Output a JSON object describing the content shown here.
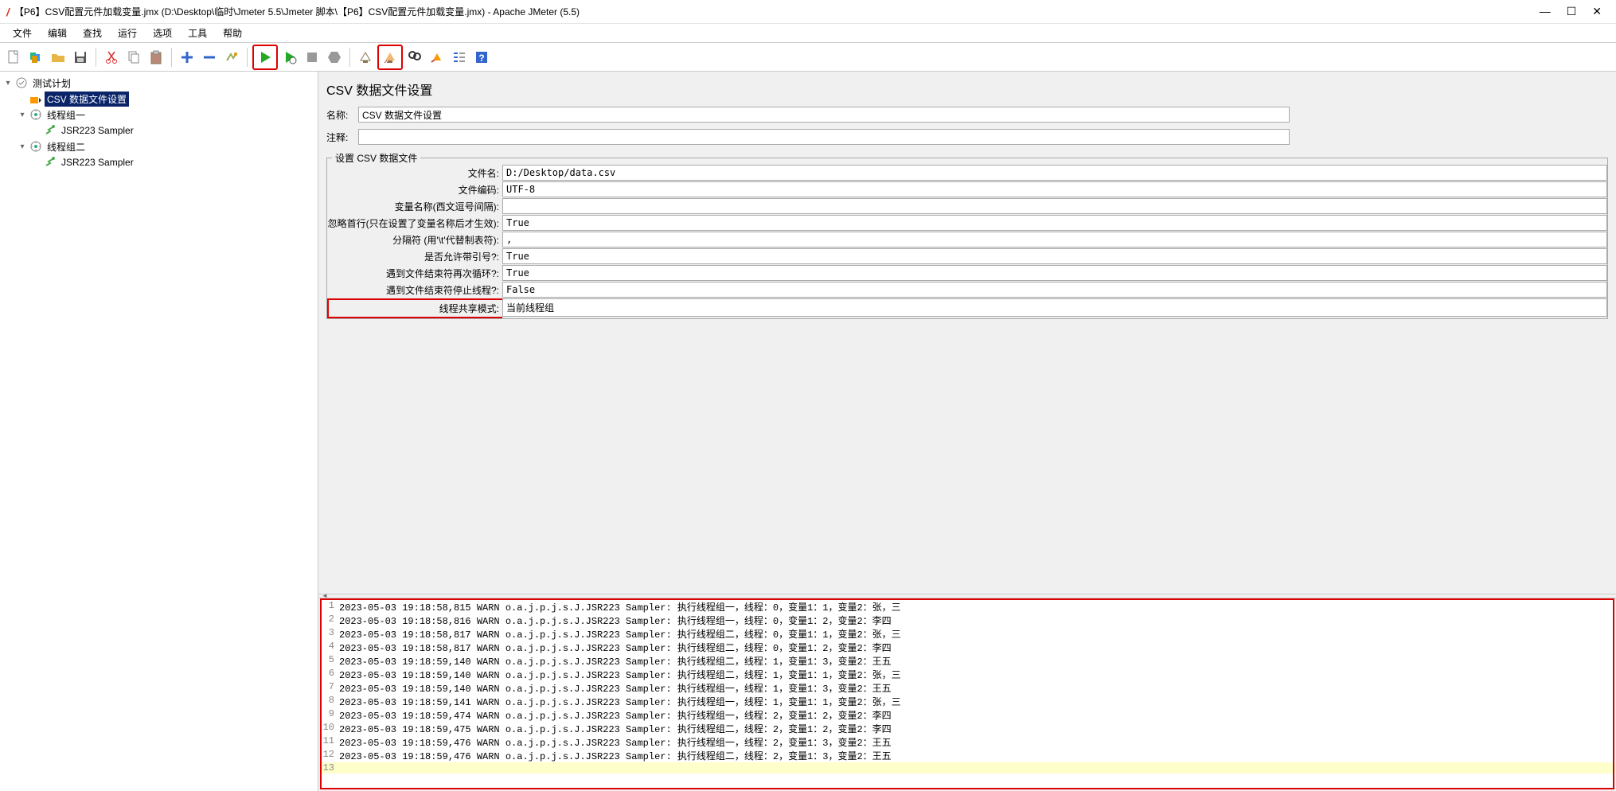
{
  "titlebar": {
    "title": "【P6】CSV配置元件加载变量.jmx (D:\\Desktop\\临时\\Jmeter 5.5\\Jmeter 脚本\\【P6】CSV配置元件加载变量.jmx) - Apache JMeter (5.5)"
  },
  "menu": {
    "file": "文件",
    "edit": "编辑",
    "search": "查找",
    "run": "运行",
    "options": "选项",
    "tools": "工具",
    "help": "帮助"
  },
  "tree": {
    "root": "测试计划",
    "csv": "CSV 数据文件设置",
    "group1": "线程组一",
    "sampler1": "JSR223 Sampler",
    "group2": "线程组二",
    "sampler2": "JSR223 Sampler"
  },
  "panel": {
    "title": "CSV 数据文件设置",
    "name_label": "名称:",
    "name_value": "CSV 数据文件设置",
    "comment_label": "注释:",
    "comment_value": "",
    "fieldset_title": "设置 CSV 数据文件",
    "fields": {
      "filename_label": "文件名:",
      "filename_value": "D:/Desktop/data.csv",
      "encoding_label": "文件编码:",
      "encoding_value": "UTF-8",
      "varnames_label": "变量名称(西文逗号间隔):",
      "varnames_value": "",
      "ignore_first_label": "忽略首行(只在设置了变量名称后才生效):",
      "ignore_first_value": "True",
      "delimiter_label": "分隔符 (用'\\t'代替制表符):",
      "delimiter_value": ",",
      "quoted_label": "是否允许带引号?:",
      "quoted_value": "True",
      "recycle_label": "遇到文件结束符再次循环?:",
      "recycle_value": "True",
      "stop_label": "遇到文件结束符停止线程?:",
      "stop_value": "False",
      "share_label": "线程共享模式:",
      "share_value": "当前线程组"
    }
  },
  "log_lines": [
    {
      "n": "1",
      "t": "2023-05-03 19:18:58,815 WARN o.a.j.p.j.s.J.JSR223 Sampler: 执行线程组一，线程：0，变量1：1，变量2：张，三"
    },
    {
      "n": "2",
      "t": "2023-05-03 19:18:58,816 WARN o.a.j.p.j.s.J.JSR223 Sampler: 执行线程组一，线程：0，变量1：2，变量2：李四"
    },
    {
      "n": "3",
      "t": "2023-05-03 19:18:58,817 WARN o.a.j.p.j.s.J.JSR223 Sampler: 执行线程组二，线程：0，变量1：1，变量2：张，三"
    },
    {
      "n": "4",
      "t": "2023-05-03 19:18:58,817 WARN o.a.j.p.j.s.J.JSR223 Sampler: 执行线程组二，线程：0，变量1：2，变量2：李四"
    },
    {
      "n": "5",
      "t": "2023-05-03 19:18:59,140 WARN o.a.j.p.j.s.J.JSR223 Sampler: 执行线程组二，线程：1，变量1：3，变量2：王五"
    },
    {
      "n": "6",
      "t": "2023-05-03 19:18:59,140 WARN o.a.j.p.j.s.J.JSR223 Sampler: 执行线程组二，线程：1，变量1：1，变量2：张，三"
    },
    {
      "n": "7",
      "t": "2023-05-03 19:18:59,140 WARN o.a.j.p.j.s.J.JSR223 Sampler: 执行线程组一，线程：1，变量1：3，变量2：王五"
    },
    {
      "n": "8",
      "t": "2023-05-03 19:18:59,141 WARN o.a.j.p.j.s.J.JSR223 Sampler: 执行线程组一，线程：1，变量1：1，变量2：张，三"
    },
    {
      "n": "9",
      "t": "2023-05-03 19:18:59,474 WARN o.a.j.p.j.s.J.JSR223 Sampler: 执行线程组一，线程：2，变量1：2，变量2：李四"
    },
    {
      "n": "10",
      "t": "2023-05-03 19:18:59,475 WARN o.a.j.p.j.s.J.JSR223 Sampler: 执行线程组二，线程：2，变量1：2，变量2：李四"
    },
    {
      "n": "11",
      "t": "2023-05-03 19:18:59,476 WARN o.a.j.p.j.s.J.JSR223 Sampler: 执行线程组一，线程：2，变量1：3，变量2：王五"
    },
    {
      "n": "12",
      "t": "2023-05-03 19:18:59,476 WARN o.a.j.p.j.s.J.JSR223 Sampler: 执行线程组二，线程：2，变量1：3，变量2：王五"
    },
    {
      "n": "13",
      "t": ""
    }
  ]
}
